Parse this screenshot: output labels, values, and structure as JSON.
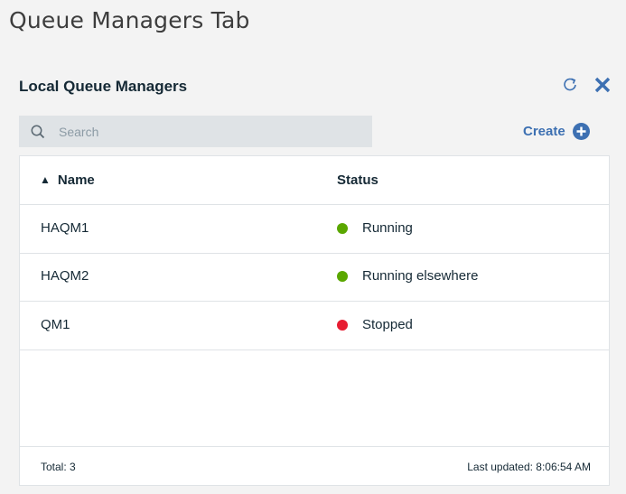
{
  "page": {
    "title": "Queue Managers Tab"
  },
  "widget": {
    "title": "Local Queue Managers",
    "refresh_icon": "refresh-icon",
    "close_icon": "close-icon"
  },
  "search": {
    "placeholder": "Search",
    "value": "",
    "icon": "search-icon"
  },
  "create": {
    "label": "Create",
    "icon": "add-circle-icon"
  },
  "table": {
    "columns": {
      "name": "Name",
      "status": "Status"
    },
    "sort_icon": "sort-ascending-icon",
    "rows": [
      {
        "name": "HAQM1",
        "status": "Running",
        "status_color": "#5aa700"
      },
      {
        "name": "HAQM2",
        "status": "Running elsewhere",
        "status_color": "#5aa700"
      },
      {
        "name": "QM1",
        "status": "Stopped",
        "status_color": "#e71d32"
      }
    ],
    "footer": {
      "total": "Total: 3",
      "last_updated": "Last updated: 8:06:54 AM"
    }
  },
  "colors": {
    "accent": "#3d70b2",
    "running": "#5aa700",
    "stopped": "#e71d32",
    "search_bg": "#dfe3e6",
    "page_bg": "#f3f3f3"
  }
}
